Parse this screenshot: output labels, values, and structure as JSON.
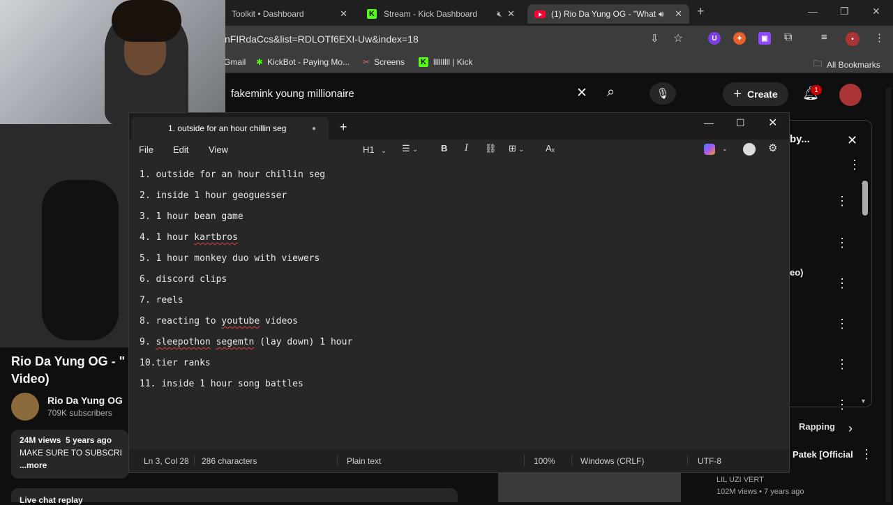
{
  "browser": {
    "tabs": [
      {
        "label": "Toolkit • Dashboard"
      },
      {
        "label": "Stream - Kick Dashboard"
      },
      {
        "label": "(1) Rio Da Yung OG - \"What"
      }
    ],
    "url": "nFIRdaCcs&list=RDLOTf6EXI-Uw&index=18",
    "bookmarks": [
      {
        "label": "Gmail"
      },
      {
        "label": "KickBot - Paying Mo..."
      },
      {
        "label": "Screens"
      },
      {
        "label": "lllllllll | Kick"
      }
    ],
    "all_bookmarks": "All Bookmarks"
  },
  "youtube": {
    "search_value": "fakemink young millionaire",
    "create_label": "Create",
    "notification_count": "1",
    "video_title": "Rio Da Yung OG - \" Video)",
    "channel_name": "Rio Da Yung OG",
    "subscribers": "709K subscribers",
    "views": "24M views",
    "age": "5 years ago",
    "desc_snippet": "MAKE SURE TO SUBSCRI",
    "more": "...more",
    "live_chat": "Live chat replay",
    "panel_title_frag": "by...",
    "panel_item_frag": "eo)",
    "chip": "Rapping",
    "rec_title_frag": "Patek [Official",
    "rec_channel": "LIL UZI VERT",
    "rec_meta": "102M views • 7 years ago"
  },
  "notepad": {
    "tab_title": "1. outside for an hour chillin seg",
    "menu": {
      "file": "File",
      "edit": "Edit",
      "view": "View"
    },
    "heading_dropdown": "H1",
    "lines": [
      {
        "n": "1. ",
        "text": "outside for an hour chillin seg"
      },
      {
        "n": "2. ",
        "text": "inside 1 hour geoguesser"
      },
      {
        "n": "3. ",
        "text": "1 hour bean game"
      },
      {
        "n": "4. ",
        "pre": "1 hour ",
        "sq": "kartbros",
        "post": ""
      },
      {
        "n": "5. ",
        "text": "1 hour monkey duo with viewers"
      },
      {
        "n": "6. ",
        "text": "discord clips"
      },
      {
        "n": "7. ",
        "text": "reels"
      },
      {
        "n": "8. ",
        "pre": "reacting to ",
        "sq": "youtube",
        "post": " videos"
      },
      {
        "n": "9. ",
        "sq": "sleepothon",
        "mid": " ",
        "sq2": "segemtn",
        "post": " (lay down) 1 hour"
      },
      {
        "n": "10.",
        "text": "tier ranks"
      },
      {
        "n": "11. ",
        "text": "inside 1 hour song battles"
      }
    ],
    "status": {
      "position": "Ln 3, Col 28",
      "chars": "286 characters",
      "format": "Plain text",
      "zoom": "100%",
      "line_ending": "Windows (CRLF)",
      "encoding": "UTF-8"
    }
  },
  "colors": {
    "kick_green": "#53fc18",
    "youtube_red": "#ff0033",
    "spellcheck_red": "#e04040"
  }
}
